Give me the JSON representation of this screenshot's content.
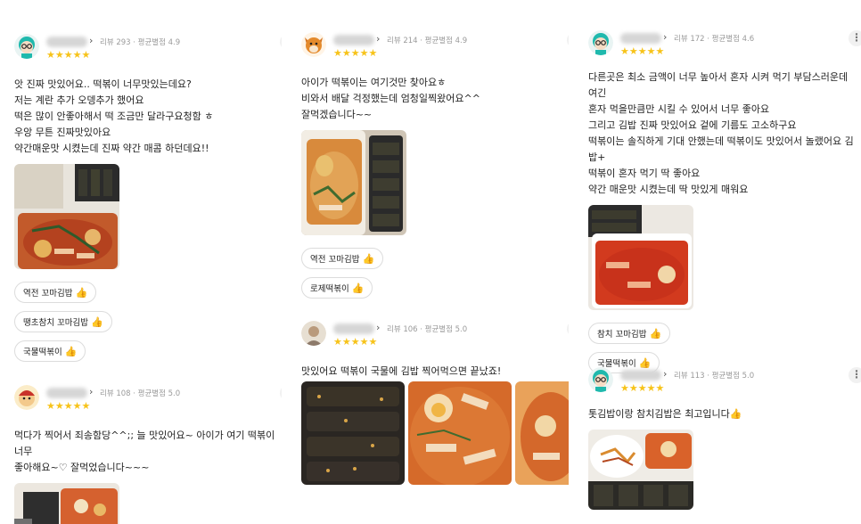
{
  "reviews": [
    {
      "meta": "리뷰 293 · 평균별점 4.9",
      "stars": "★★★★★",
      "text": "앗 진짜 맛있어요.. 떡볶이 너무맛있는데요?\n저는 계란 추가 오뎅추가 했어요\n떡은 많이 안좋아해서 떡 조금만 달라구요청함 ㅎ\n우앙 무튼 진짜맛있아요\n약간매운맛 시켰는데 진짜 약간 매콤 하던데요!!",
      "chips": [
        "역전 꼬마김밥",
        "땡초참치 꼬마김밥",
        "국물떡볶이"
      ]
    },
    {
      "meta": "리뷰 108 · 평균별점 5.0",
      "stars": "★★★★★",
      "text": "먹다가 찍어서 죄송함당^^;; 늘 맛있어요~ 아이가 여기  떡볶이 너무\n좋아해요~♡ 잘먹었습니다~~~",
      "chips": []
    },
    {
      "meta": "리뷰 214 · 평균별점 4.9",
      "stars": "★★★★★",
      "text": "아이가 떡볶이는 여기것만 찾아요ㅎ\n비와서 배달 걱정했는데 엄청일찍왔어요^^\n잘먹겠습니다~~",
      "chips": [
        "역전 꼬마김밥",
        "로제떡볶이"
      ]
    },
    {
      "meta": "리뷰 106 · 평균별점 5.0",
      "stars": "★★★★★",
      "text": "맛있어요 떡볶이 국물에 김밥 찍어먹으면  끝났죠!",
      "chips": []
    },
    {
      "meta": "리뷰 172 · 평균별점 4.6",
      "stars": "★★★★★",
      "text": "다른곳은 최소 금액이 너무 높아서 혼자 시켜 먹기 부담스러운데 여긴\n혼자 먹을만큼만 시킬 수 있어서 너무 좋아요\n그리고 김밥 진짜 맛있어요 겉에 기름도 고소하구요\n떡볶이는 솔직하게 기대 안했는데 떡볶이도 맛있어서 놀랬어요 김밥+\n떡볶이 혼자 먹기 딱 좋아요\n약간 매운맛 시켰는데 딱 맛있게 매워요",
      "chips": [
        "참치 꼬마김밥",
        "국물떡볶이"
      ]
    },
    {
      "meta": "리뷰 113 · 평균별점 5.0",
      "stars": "★★★★★",
      "text": "톳김밥이랑 참치김밥은 최고입니다👍",
      "chips": []
    }
  ],
  "icons": {
    "more": "more-vertical-icon",
    "chevron": "chevron-right-icon",
    "thumb": "thumbs-up-icon"
  },
  "colors": {
    "star": "#f7c31a",
    "thumb": "#1ec0b4",
    "meta": "#9a9a9a"
  }
}
